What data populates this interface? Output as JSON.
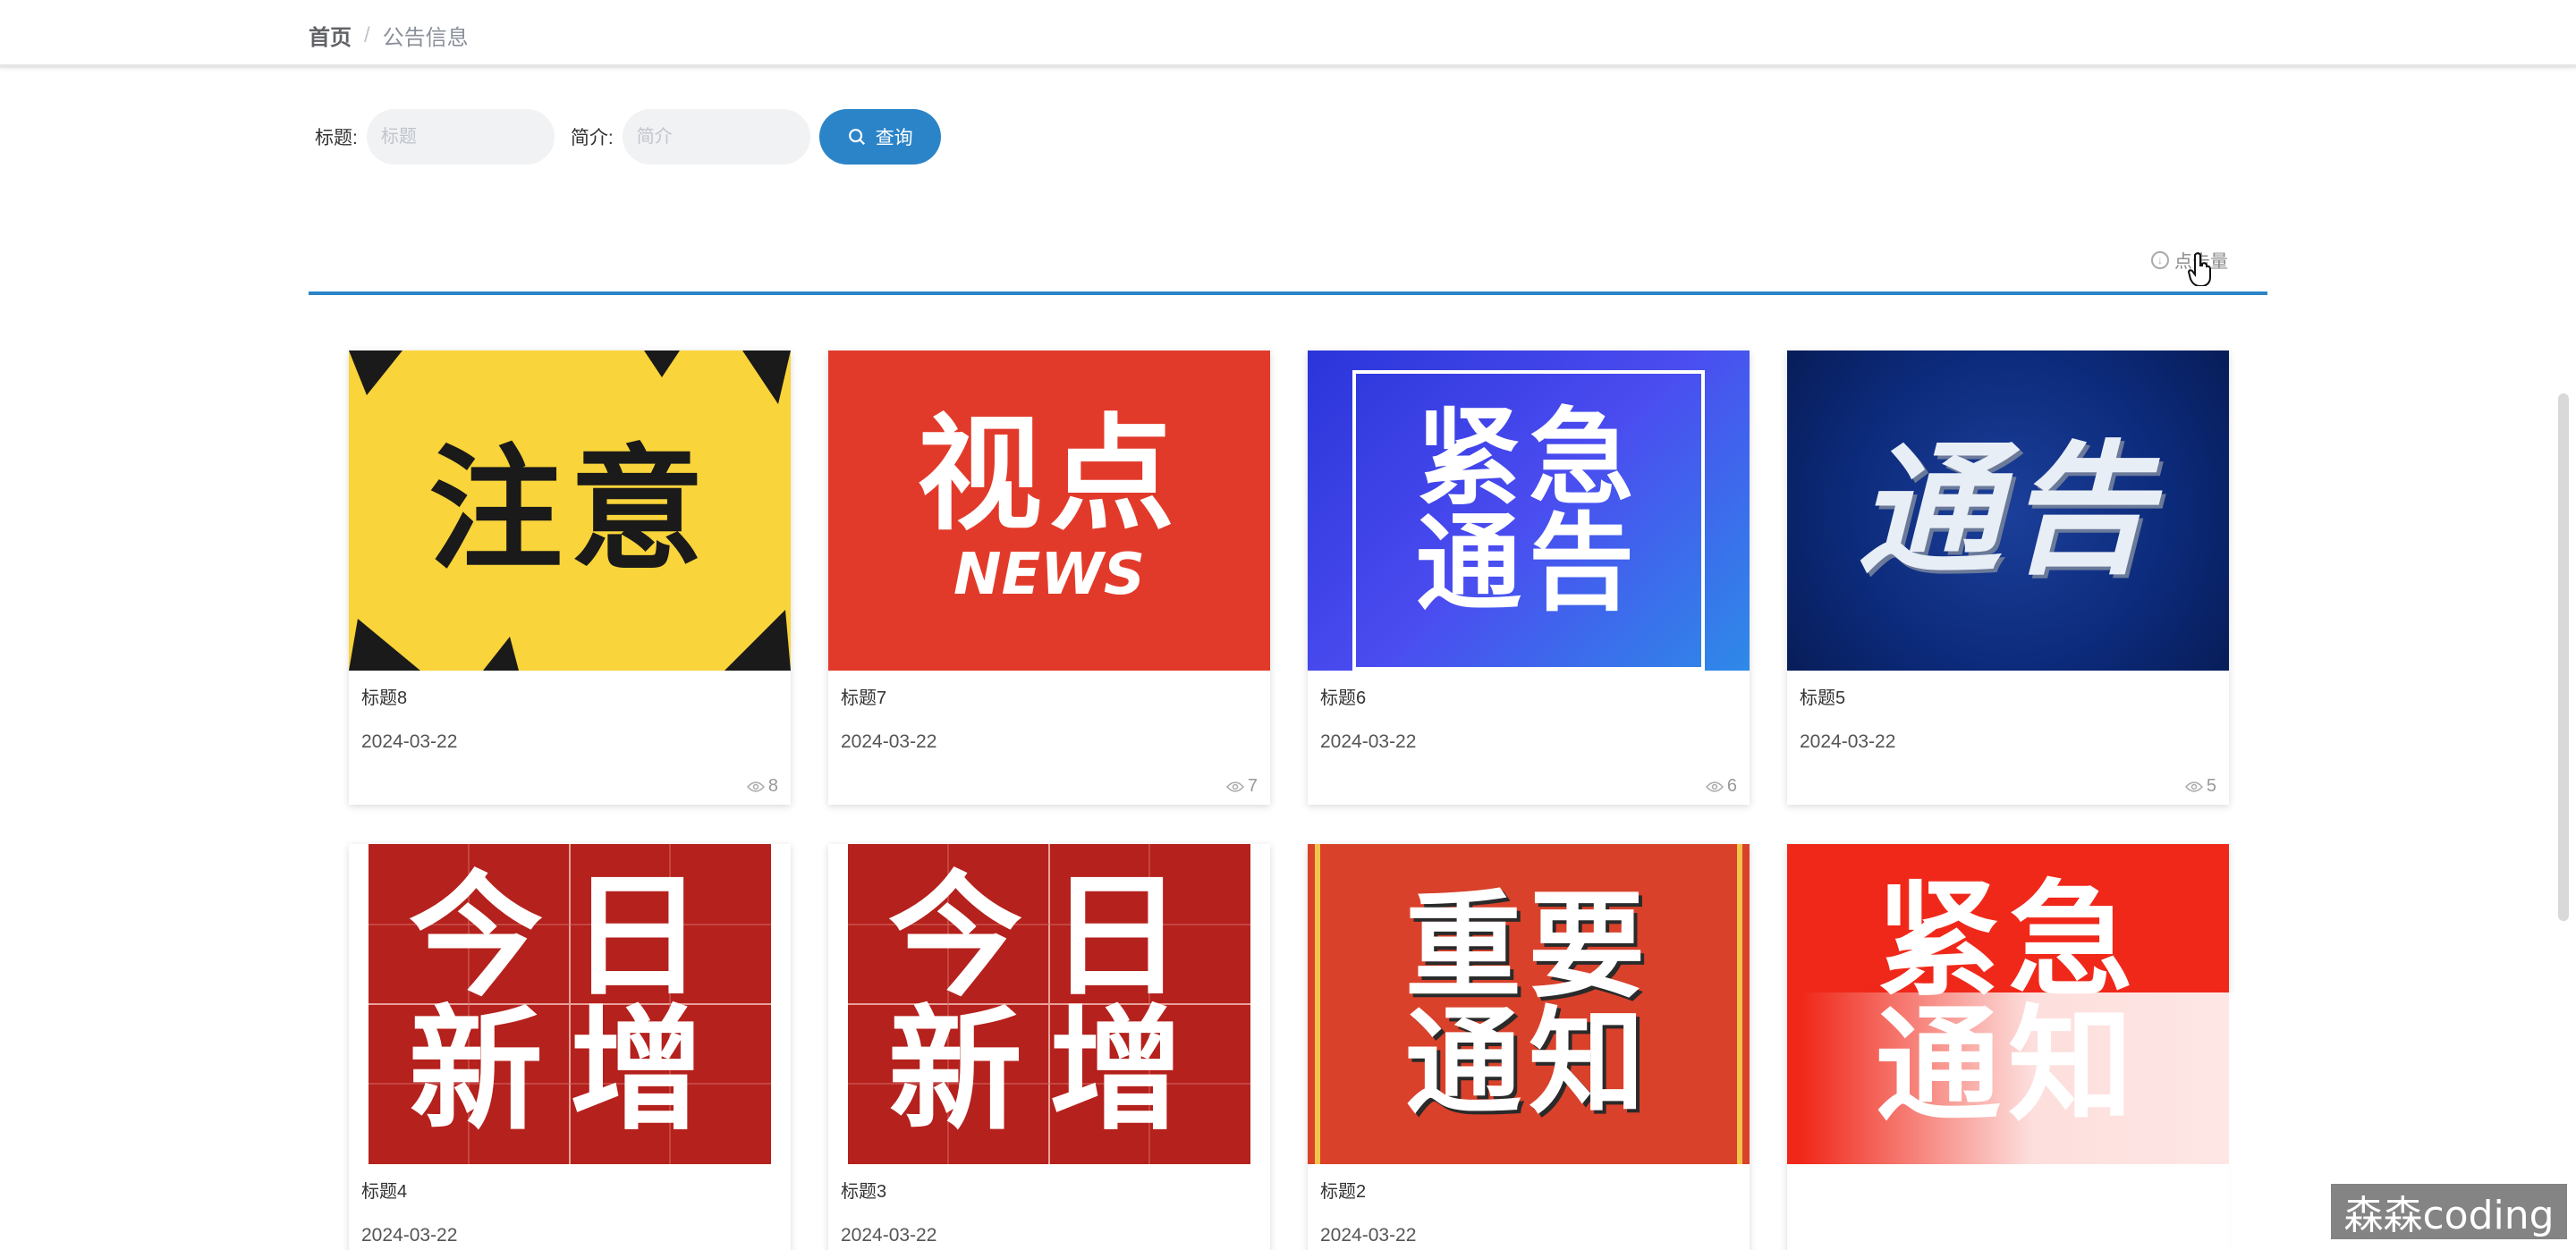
{
  "breadcrumb": {
    "home": "首页",
    "separator": "/",
    "current": "公告信息"
  },
  "search": {
    "title_label": "标题:",
    "title_placeholder": "标题",
    "intro_label": "简介:",
    "intro_placeholder": "简介",
    "query_button": "查询",
    "accent_color": "#2b84c8"
  },
  "sort": {
    "label": "点击量",
    "icon": "sort-icon"
  },
  "cards": [
    {
      "title": "标题8",
      "date": "2024-03-22",
      "views": "8",
      "image_text": "注意",
      "image_sub": "",
      "bg": "#f9d43a",
      "fg": "#1a1a1a"
    },
    {
      "title": "标题7",
      "date": "2024-03-22",
      "views": "7",
      "image_text": "视点",
      "image_sub": "NEWS",
      "bg": "#e23a2a",
      "fg": "#ffffff"
    },
    {
      "title": "标题6",
      "date": "2024-03-22",
      "views": "6",
      "image_text": "紧急\n通告",
      "image_sub": "",
      "bg": "#3b3ee0",
      "fg": "#ffffff"
    },
    {
      "title": "标题5",
      "date": "2024-03-22",
      "views": "5",
      "image_text": "通告",
      "image_sub": "",
      "bg": "#0c2a7a",
      "fg": "#e8eef6"
    },
    {
      "title": "标题4",
      "date": "2024-03-22",
      "views": "",
      "image_text": "今日\n新增",
      "image_sub": "",
      "bg": "#b5211d",
      "fg": "#ffffff"
    },
    {
      "title": "标题3",
      "date": "2024-03-22",
      "views": "",
      "image_text": "今日\n新增",
      "image_sub": "",
      "bg": "#b5211d",
      "fg": "#ffffff"
    },
    {
      "title": "标题2",
      "date": "2024-03-22",
      "views": "",
      "image_text": "重要\n通知",
      "image_sub": "",
      "bg": "#d9412b",
      "fg": "#ffffff"
    },
    {
      "title": "",
      "date": "",
      "views": "",
      "image_text": "紧急\n通知",
      "image_sub": "",
      "bg": "#f0281a",
      "fg": "#ffffff"
    }
  ],
  "watermark": "森森coding"
}
